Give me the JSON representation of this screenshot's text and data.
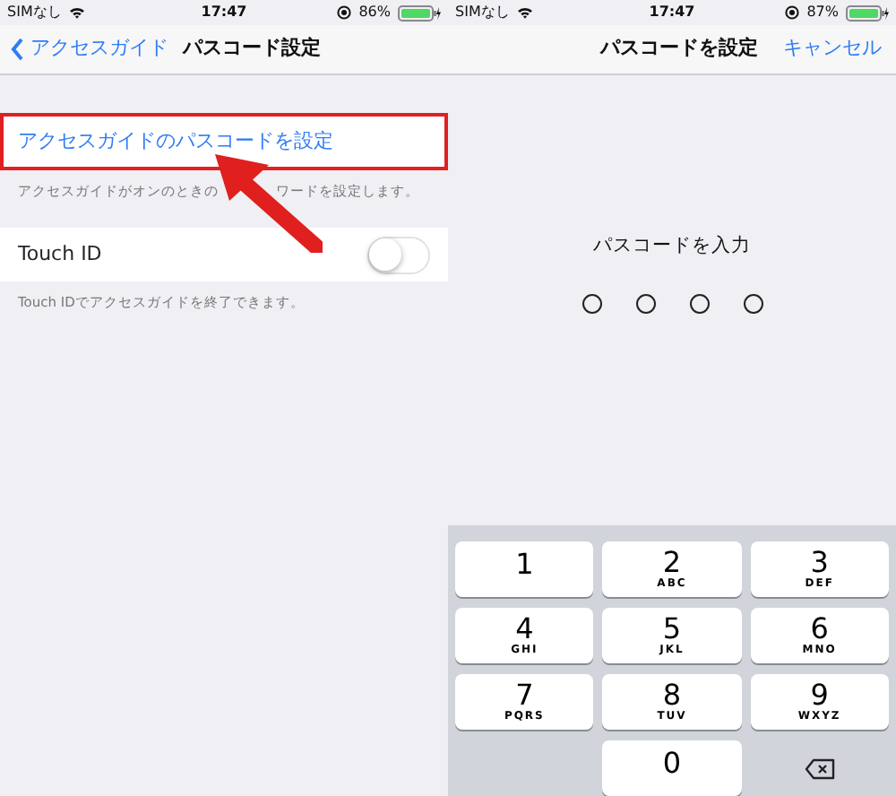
{
  "left_screen": {
    "status_bar": {
      "carrier": "SIMなし",
      "time": "17:47",
      "battery": "86%"
    },
    "nav": {
      "back": "アクセスガイド",
      "title": "パスコード設定"
    },
    "passcode_row": {
      "label": "アクセスガイドのパスコードを設定",
      "highlighted": true
    },
    "passcode_footer": [
      "アクセスガイドがオンのときの",
      "ワードを設定します。"
    ],
    "touch_id": {
      "label": "Touch ID",
      "on": false
    },
    "touch_id_footer": "Touch IDでアクセスガイドを終了できます。"
  },
  "right_screen": {
    "status_bar": {
      "carrier": "SIMなし",
      "time": "17:47",
      "battery": "87%"
    },
    "nav": {
      "title": "パスコードを設定",
      "cancel": "キャンセル"
    },
    "prompt": "パスコードを入力",
    "dots": [
      {
        "filled": false
      },
      {
        "filled": false
      },
      {
        "filled": false
      },
      {
        "filled": false
      }
    ],
    "keypad": [
      {
        "kind": "digit",
        "digit": "1"
      },
      {
        "kind": "digit",
        "digit": "2",
        "letters": "ABC"
      },
      {
        "kind": "digit",
        "digit": "3",
        "letters": "DEF"
      },
      {
        "kind": "digit",
        "digit": "4",
        "letters": "GHI"
      },
      {
        "kind": "digit",
        "digit": "5",
        "letters": "JKL"
      },
      {
        "kind": "digit",
        "digit": "6",
        "letters": "MNO"
      },
      {
        "kind": "digit",
        "digit": "7",
        "letters": "PQRS"
      },
      {
        "kind": "digit",
        "digit": "8",
        "letters": "TUV"
      },
      {
        "kind": "digit",
        "digit": "9",
        "letters": "WXYZ"
      },
      {
        "kind": "blank"
      },
      {
        "kind": "digit",
        "digit": "0"
      },
      {
        "kind": "delete"
      }
    ]
  }
}
